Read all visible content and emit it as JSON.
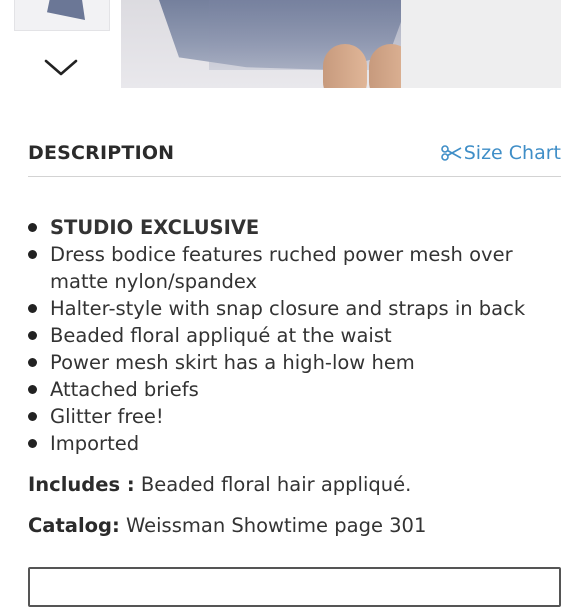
{
  "gallery": {
    "thumbnail_label": "",
    "next_icon": "chevron-down-icon"
  },
  "description": {
    "title": "DESCRIPTION",
    "size_chart_label": "Size Chart",
    "size_chart_icon": "scissors-icon",
    "bullets": [
      "STUDIO EXCLUSIVE",
      "Dress bodice features ruched power mesh over matte nylon/spandex",
      "Halter-style with snap closure and straps in back",
      "Beaded floral appliqué at the waist",
      "Power mesh skirt has a high-low hem",
      "Attached briefs",
      "Glitter free!",
      "Imported"
    ],
    "includes_label": "Includes :",
    "includes_value": "Beaded floral hair appliqué.",
    "catalog_label": "Catalog:",
    "catalog_value": "Weissman Showtime page 301"
  },
  "colors": {
    "accent_link": "#3f8ec7",
    "text": "#333333"
  }
}
